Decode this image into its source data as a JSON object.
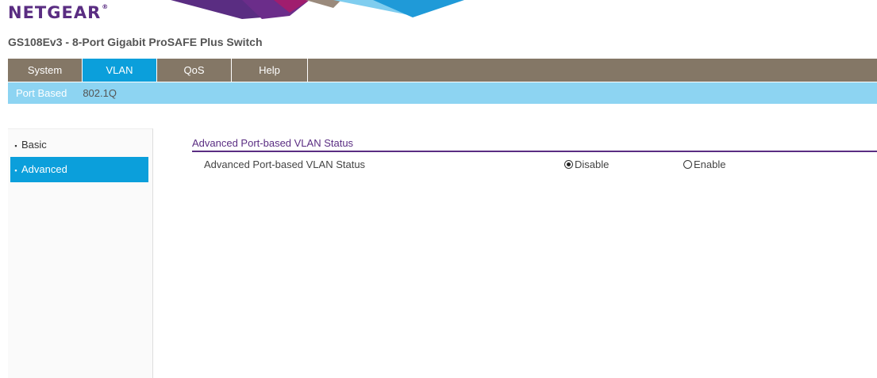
{
  "brand": {
    "logo": "NETGEAR",
    "registered": "®"
  },
  "product_title": "GS108Ev3 - 8-Port Gigabit ProSAFE Plus Switch",
  "top_nav": {
    "tabs": [
      "System",
      "VLAN",
      "QoS",
      "Help"
    ],
    "active": "VLAN"
  },
  "sub_nav": {
    "tabs": [
      "Port Based",
      "802.1Q"
    ],
    "active": "Port Based"
  },
  "sidebar": {
    "items": [
      "Basic",
      "Advanced"
    ],
    "active": "Advanced"
  },
  "content": {
    "section_title": "Advanced Port-based VLAN Status",
    "row_label": "Advanced Port-based VLAN Status",
    "options": [
      "Disable",
      "Enable"
    ],
    "selected": "Disable"
  },
  "colors": {
    "brand_purple": "#5a2d82",
    "nav_brown": "#847766",
    "active_blue": "#0b9fdb",
    "subnav_blue": "#8dd4f2"
  }
}
